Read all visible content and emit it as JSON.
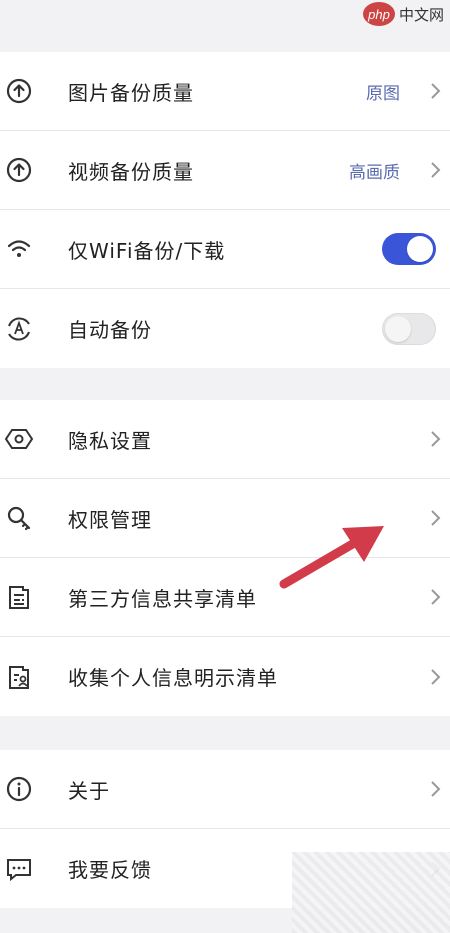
{
  "watermark": {
    "logo": "php",
    "text": "中文网"
  },
  "backup": {
    "items": [
      {
        "label": "图片备份质量",
        "value": "原图",
        "icon": "upload-circle-icon"
      },
      {
        "label": "视频备份质量",
        "value": "高画质",
        "icon": "upload-circle-icon"
      },
      {
        "label": "仅WiFi备份/下载",
        "toggle": true,
        "icon": "wifi-icon"
      },
      {
        "label": "自动备份",
        "toggle": false,
        "icon": "auto-sync-icon"
      }
    ]
  },
  "privacy": {
    "items": [
      {
        "label": "隐私设置",
        "icon": "hexagon-eye-icon"
      },
      {
        "label": "权限管理",
        "icon": "key-icon"
      },
      {
        "label": "第三方信息共享清单",
        "icon": "share-document-icon"
      },
      {
        "label": "收集个人信息明示清单",
        "icon": "person-document-icon"
      }
    ]
  },
  "misc": {
    "items": [
      {
        "label": "关于",
        "icon": "info-icon"
      },
      {
        "label": "我要反馈",
        "icon": "feedback-icon"
      }
    ]
  },
  "colors": {
    "accent": "#3b55d9",
    "value_text": "#5a6bb0",
    "annotation_arrow": "#d23b4a"
  }
}
